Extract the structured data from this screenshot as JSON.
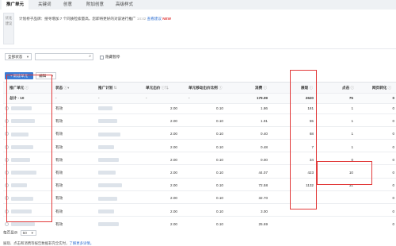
{
  "tabs": [
    {
      "label": "推广单元",
      "active": true
    },
    {
      "label": "关键词",
      "active": false
    },
    {
      "label": "创意",
      "active": false
    },
    {
      "label": "附加创意",
      "active": false
    },
    {
      "label": "高级样式",
      "active": false
    }
  ],
  "tip": {
    "side_label": "优化建议",
    "text": "计划桥子品牌：搜寻增加 7 个同质检索量高，您即将更好的对该进行推广",
    "time": "14:42",
    "link": "查看建议",
    "badge": "NEW"
  },
  "filters": {
    "status_value": "全部状态",
    "search_placeholder": "",
    "checkbox_label": "隐藏暂停"
  },
  "actions": {
    "add_label": "+ 新建单元",
    "edit_label": "编辑"
  },
  "table": {
    "headers": {
      "unit": "推广单元",
      "status": "状态",
      "plan": "推广计划",
      "bid": "单元出价",
      "ratio": "单元移动出价比例",
      "cost": "消费",
      "impressions": "展现",
      "clicks": "点击",
      "conv": "网页转化"
    },
    "total": {
      "label": "总计 - 10",
      "cost": "179.09",
      "impressions": "2620",
      "clicks": "75",
      "conv": "0"
    },
    "rows": [
      {
        "status": "有效",
        "bid": "2.00",
        "ratio": "0.10",
        "cost": "1.86",
        "impressions": "181",
        "clicks": "1",
        "conv": "0"
      },
      {
        "status": "有效",
        "bid": "2.00",
        "ratio": "0.10",
        "cost": "1.91",
        "impressions": "55",
        "clicks": "1",
        "conv": "0"
      },
      {
        "status": "有效",
        "bid": "2.00",
        "ratio": "0.10",
        "cost": "0.40",
        "impressions": "68",
        "clicks": "1",
        "conv": "0"
      },
      {
        "status": "有效",
        "bid": "2.00",
        "ratio": "0.10",
        "cost": "0.48",
        "impressions": "7",
        "clicks": "1",
        "conv": "0"
      },
      {
        "status": "有效",
        "bid": "2.00",
        "ratio": "0.10",
        "cost": "0.00",
        "impressions": "34",
        "clicks": "0",
        "conv": "0"
      },
      {
        "status": "有效",
        "bid": "2.00",
        "ratio": "0.10",
        "cost": "44.07",
        "impressions": "423",
        "clicks": "10",
        "conv": "0"
      },
      {
        "status": "有效",
        "bid": "2.00",
        "ratio": "0.10",
        "cost": "72.58",
        "impressions": "1132",
        "clicks": "31",
        "conv": "0"
      },
      {
        "status": "有效",
        "bid": "2.00",
        "ratio": "0.10",
        "cost": "32.70",
        "impressions": "",
        "clicks": "",
        "conv": "0"
      },
      {
        "status": "有效",
        "bid": "2.00",
        "ratio": "0.10",
        "cost": "3.00",
        "impressions": "",
        "clicks": "",
        "conv": "0"
      },
      {
        "status": "有效",
        "bid": "2.00",
        "ratio": "0.10",
        "cost": "25.69",
        "impressions": "",
        "clicks": "",
        "conv": "0"
      }
    ]
  },
  "pagination": {
    "label": "每页显示",
    "value": "50"
  },
  "footer_note": {
    "text": "展现、点击和消费等报告数据非完全实时，",
    "link": "了解更多详情。"
  },
  "colors": {
    "accent": "#3a7bd5",
    "highlight": "#e23b3b",
    "link": "#2f6fd1"
  }
}
